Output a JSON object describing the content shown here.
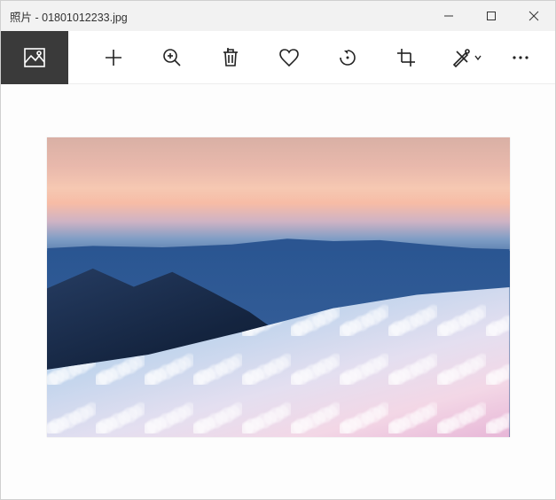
{
  "window": {
    "app_name": "照片",
    "separator": " - ",
    "file_name": "01801012233.jpg"
  },
  "toolbar": {
    "photo_tab": "photo",
    "add": "add",
    "zoom": "zoom",
    "delete": "delete",
    "favorite": "favorite",
    "rotate": "rotate",
    "crop": "crop",
    "draw": "draw",
    "more": "more"
  }
}
